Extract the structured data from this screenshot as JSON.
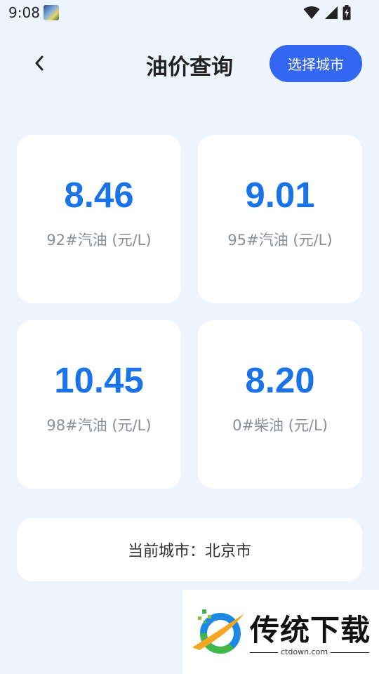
{
  "status_bar": {
    "time": "9:08",
    "icons": [
      "wifi-icon",
      "signal-icon",
      "battery-charging-icon"
    ]
  },
  "header": {
    "title": "油价查询",
    "back_icon": "chevron-left-icon",
    "select_city_label": "选择城市"
  },
  "prices": [
    {
      "value": "8.46",
      "label": "92#汽油 (元/L)"
    },
    {
      "value": "9.01",
      "label": "95#汽油 (元/L)"
    },
    {
      "value": "10.45",
      "label": "98#汽油 (元/L)"
    },
    {
      "value": "8.20",
      "label": "0#柴油 (元/L)"
    }
  ],
  "current_city": "当前城市：北京市",
  "watermark": {
    "title": "传统下载",
    "url": "ctdown.com"
  },
  "colors": {
    "background": "#eef4fd",
    "accent": "#3366f1",
    "price": "#1a73e8",
    "label": "#8a8f96"
  }
}
